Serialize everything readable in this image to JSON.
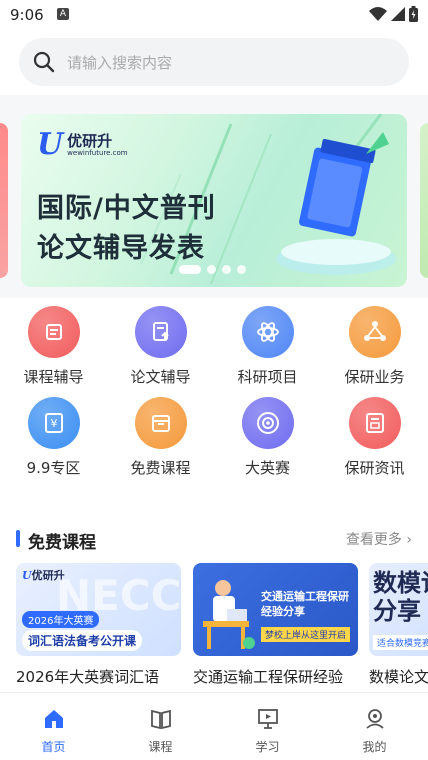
{
  "status_bar": {
    "time": "9:06",
    "notif_letter": "A"
  },
  "search": {
    "placeholder": "请输入搜索内容"
  },
  "banner": {
    "logo_brand": "优研升",
    "logo_url": "wewinfuture.com",
    "line1": "国际/中文普刊",
    "line2": "论文辅导发表",
    "active_dot": 0,
    "dot_count": 4
  },
  "features": [
    {
      "label": "课程辅导",
      "icon": "book-reader-icon",
      "color": "#f25c5c"
    },
    {
      "label": "论文辅导",
      "icon": "paper-upload-icon",
      "color": "#6f6cf0"
    },
    {
      "label": "科研项目",
      "icon": "atom-icon",
      "color": "#4f86f5"
    },
    {
      "label": "保研业务",
      "icon": "network-icon",
      "color": "#f59a3b"
    },
    {
      "label": "9.9专区",
      "icon": "yuan-tag-icon",
      "color": "#3b8ff2"
    },
    {
      "label": "免费课程",
      "icon": "box-icon",
      "color": "#f59a3b"
    },
    {
      "label": "大英赛",
      "icon": "target-icon",
      "color": "#6f6cf0"
    },
    {
      "label": "保研资讯",
      "icon": "news-icon",
      "color": "#f25c5c"
    }
  ],
  "free_courses": {
    "title": "免费课程",
    "more": "查看更多",
    "items": [
      {
        "title": "2026年大英赛词汇语",
        "thumb_brand": "优研升",
        "thumb_tag": "2026年大英赛",
        "thumb_heading": "词汇语法备考公开课"
      },
      {
        "title": "交通运输工程保研经验",
        "thumb_heading": "交通运输工程保研经验分享",
        "thumb_sub": "梦校上岸从这里开启"
      },
      {
        "title": "数模论文",
        "thumb_heading": "数模论文经验分享",
        "thumb_sub": "适合数模竞赛"
      }
    ]
  },
  "bottom_nav": [
    {
      "label": "首页",
      "icon": "home-icon",
      "active": true
    },
    {
      "label": "课程",
      "icon": "book-icon",
      "active": false
    },
    {
      "label": "学习",
      "icon": "presentation-icon",
      "active": false
    },
    {
      "label": "我的",
      "icon": "profile-icon",
      "active": false
    }
  ],
  "colors": {
    "accent": "#2f6bff",
    "search_bg": "#f2f3f5"
  }
}
